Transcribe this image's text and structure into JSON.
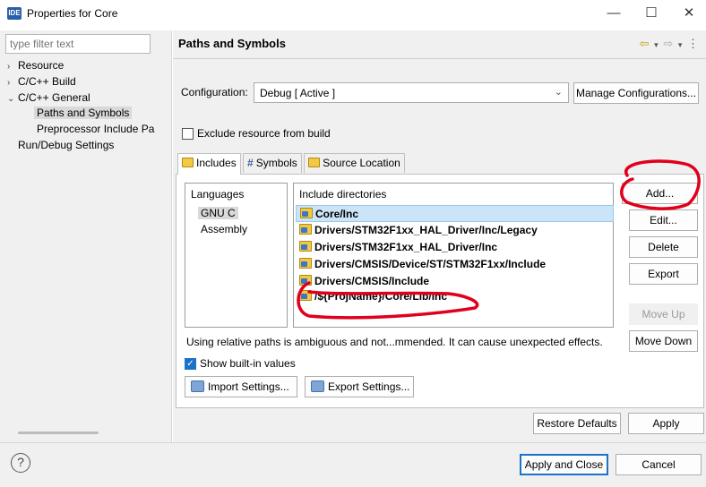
{
  "window": {
    "icon_text": "IDE",
    "title": "Properties for Core",
    "minimize": "—",
    "maximize": "☐",
    "close": "✕"
  },
  "sidebar": {
    "filter_placeholder": "type filter text",
    "items": [
      {
        "arrow": "›",
        "label": "Resource"
      },
      {
        "arrow": "›",
        "label": "C/C++ Build"
      },
      {
        "arrow": "⌄",
        "label": "C/C++ General"
      },
      {
        "arrow": "",
        "label": "Paths and Symbols"
      },
      {
        "arrow": "",
        "label": "Preprocessor Include Pa"
      },
      {
        "arrow": "",
        "label": "Run/Debug Settings"
      }
    ]
  },
  "header": {
    "title": "Paths and Symbols",
    "nav": [
      "⇦",
      "▾",
      "⇨",
      "▾",
      "⋮"
    ]
  },
  "configuration": {
    "label": "Configuration:",
    "value": "Debug  [ Active ]",
    "chevron": "⌄",
    "manage_button": "Manage Configurations..."
  },
  "exclude_checkbox": {
    "label": "Exclude resource from build",
    "checked": false
  },
  "tabs": [
    {
      "label": "Includes",
      "icon": "folder-icon",
      "active": true
    },
    {
      "label": "Symbols",
      "icon": "hash-icon",
      "active": false
    },
    {
      "label": "Source Location",
      "icon": "folder-icon",
      "active": false
    }
  ],
  "languages": {
    "header": "Languages",
    "items": [
      "GNU C",
      "Assembly"
    ],
    "selected": "GNU C"
  },
  "include_directories": {
    "header": "Include directories",
    "items": [
      "Core/Inc",
      "Drivers/STM32F1xx_HAL_Driver/Inc/Legacy",
      "Drivers/STM32F1xx_HAL_Driver/Inc",
      "Drivers/CMSIS/Device/ST/STM32F1xx/Include",
      "Drivers/CMSIS/Include",
      "/${ProjName}/Core/Lib/Inc"
    ],
    "selected": "Core/Inc"
  },
  "side_buttons": {
    "add": "Add...",
    "edit": "Edit...",
    "delete": "Delete",
    "export": "Export",
    "move_up": "Move Up",
    "move_down": "Move Down"
  },
  "warning_text": "Using relative paths is ambiguous and not...mmended. It can cause unexpected effects.",
  "show_builtin": {
    "label": "Show built-in values",
    "checked": true
  },
  "settings_buttons": {
    "import": "Import Settings...",
    "export": "Export Settings..."
  },
  "bottom_buttons": {
    "restore_defaults": "Restore Defaults",
    "apply": "Apply",
    "apply_and_close": "Apply and Close",
    "cancel": "Cancel",
    "help": "?"
  },
  "colors": {
    "annotation_red": "#e0001b",
    "accent_blue": "#1a73c8",
    "selection_blue": "#cce4f7"
  }
}
